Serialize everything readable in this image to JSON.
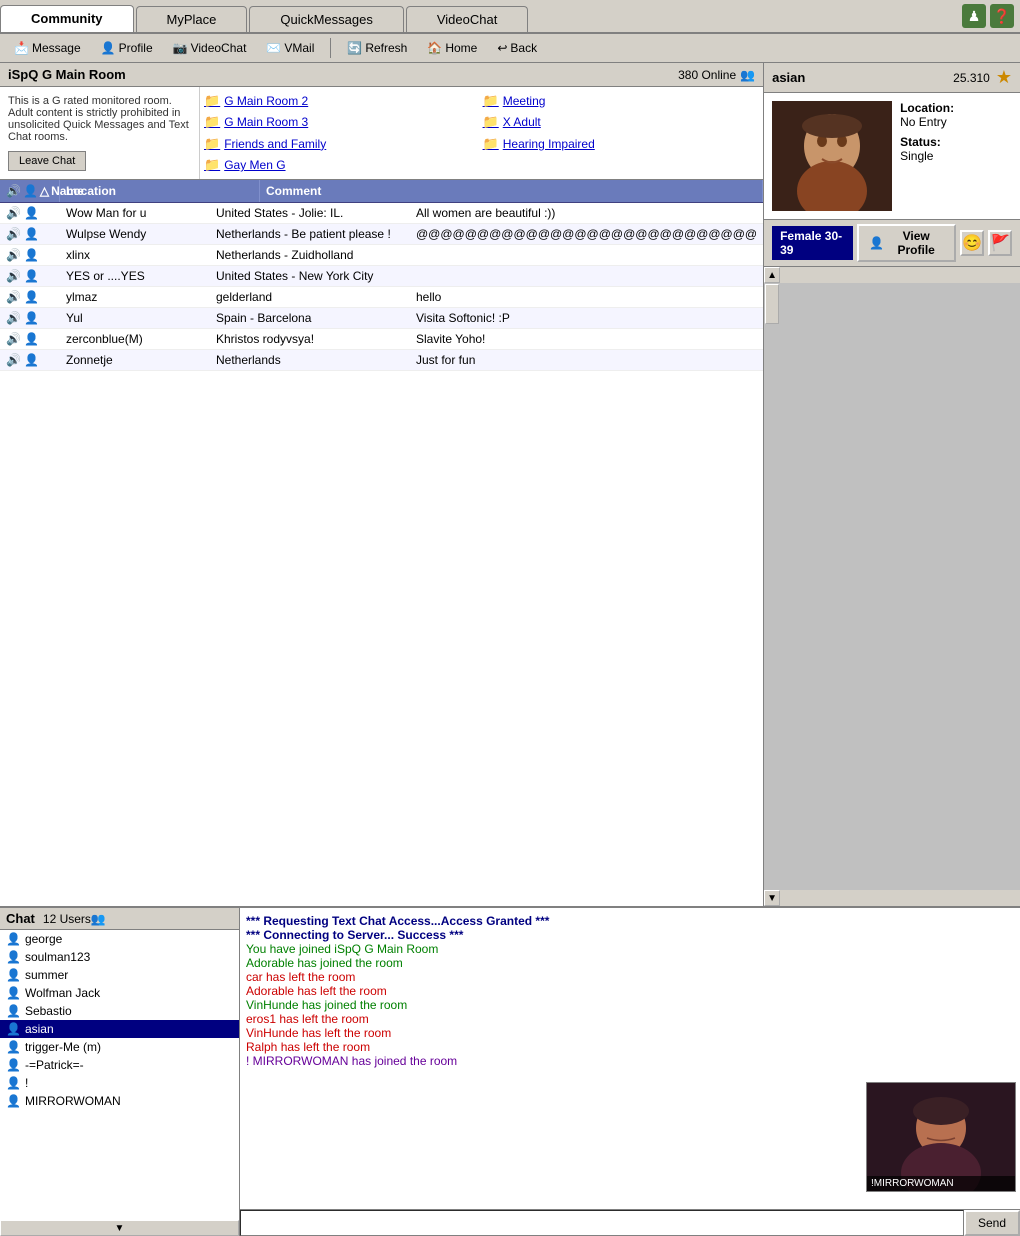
{
  "tabs": [
    {
      "label": "Community",
      "active": true
    },
    {
      "label": "MyPlace",
      "active": false
    },
    {
      "label": "QuickMessages",
      "active": false
    },
    {
      "label": "VideoChat",
      "active": false
    }
  ],
  "toolbar": {
    "buttons": [
      {
        "label": "Message",
        "icon": "📩"
      },
      {
        "label": "Profile",
        "icon": "👤"
      },
      {
        "label": "VideoChat",
        "icon": "📷"
      },
      {
        "label": "VMail",
        "icon": "✉️"
      },
      {
        "label": "Refresh",
        "icon": "🔄"
      },
      {
        "label": "Home",
        "icon": "🏠"
      },
      {
        "label": "Back",
        "icon": "↩"
      }
    ]
  },
  "room": {
    "title": "iSpQ G Main Room",
    "online": "380 Online",
    "description": "This is a G rated monitored room. Adult content is strictly prohibited in unsolicited Quick Messages and Text Chat rooms.",
    "leave_btn": "Leave Chat",
    "sub_rooms": [
      "G Main Room 2",
      "Meeting",
      "G Main Room 3",
      "X Adult",
      "Friends and Family",
      "Hearing Impaired",
      "Gay Men G"
    ]
  },
  "user_list": {
    "headers": [
      "",
      "Name",
      "Location",
      "Comment"
    ],
    "users": [
      {
        "name": "Wow Man for u",
        "location": "United States - Jolie: IL.",
        "comment": "All women are beautiful :))"
      },
      {
        "name": "Wulpse Wendy",
        "location": "Netherlands - Be patient please !",
        "comment": "@@@@@@@@@@@@@@@@@@@@@@@@@@@@"
      },
      {
        "name": "xlinx",
        "location": "Netherlands - Zuidholland",
        "comment": ""
      },
      {
        "name": "YES or ....YES",
        "location": "United States - New York City",
        "comment": ""
      },
      {
        "name": "ylmaz",
        "location": "gelderland",
        "comment": "hello"
      },
      {
        "name": "Yul",
        "location": "Spain - Barcelona",
        "comment": "Visita Softonic! :P"
      },
      {
        "name": "zerconblue(M)",
        "location": "Khristos rodyvsya!",
        "comment": "Slavite Yoho!"
      },
      {
        "name": "Zonnetje",
        "location": "Netherlands",
        "comment": "Just for fun"
      }
    ]
  },
  "profile": {
    "name": "asian",
    "points": "25.310",
    "location_label": "Location:",
    "location_value": "No Entry",
    "status_label": "Status:",
    "status_value": "Single",
    "gender_age": "Female  30-39",
    "view_profile_btn": "View Profile"
  },
  "chat": {
    "title": "Chat",
    "users_count": "12 Users",
    "users": [
      "george",
      "soulman123",
      "summer",
      "Wolfman Jack",
      "Sebastio",
      "asian",
      "trigger-Me (m)",
      "-=Patrick=-",
      "!",
      "MIRRORWOMAN"
    ],
    "selected_user": "asian",
    "messages": [
      {
        "type": "system",
        "text": "*** Requesting Text Chat Access...Access Granted ***"
      },
      {
        "type": "system",
        "text": "*** Connecting to Server... Success ***"
      },
      {
        "type": "join",
        "text": "You have joined iSpQ G Main Room"
      },
      {
        "type": "join",
        "text": "Adorable has joined the room"
      },
      {
        "type": "leave",
        "text": "car has left the room"
      },
      {
        "type": "leave",
        "text": "Adorable has left the room"
      },
      {
        "type": "join",
        "text": "VinHunde has joined the room"
      },
      {
        "type": "leave",
        "text": "eros1 has left the room"
      },
      {
        "type": "leave",
        "text": "VinHunde has left the room"
      },
      {
        "type": "leave",
        "text": "Ralph has left the room"
      },
      {
        "type": "special",
        "text": "!          MIRRORWOMAN has joined the room"
      }
    ],
    "input_placeholder": "",
    "send_btn": "Send"
  },
  "video": {
    "label": "!MIRRORWOMAN"
  }
}
